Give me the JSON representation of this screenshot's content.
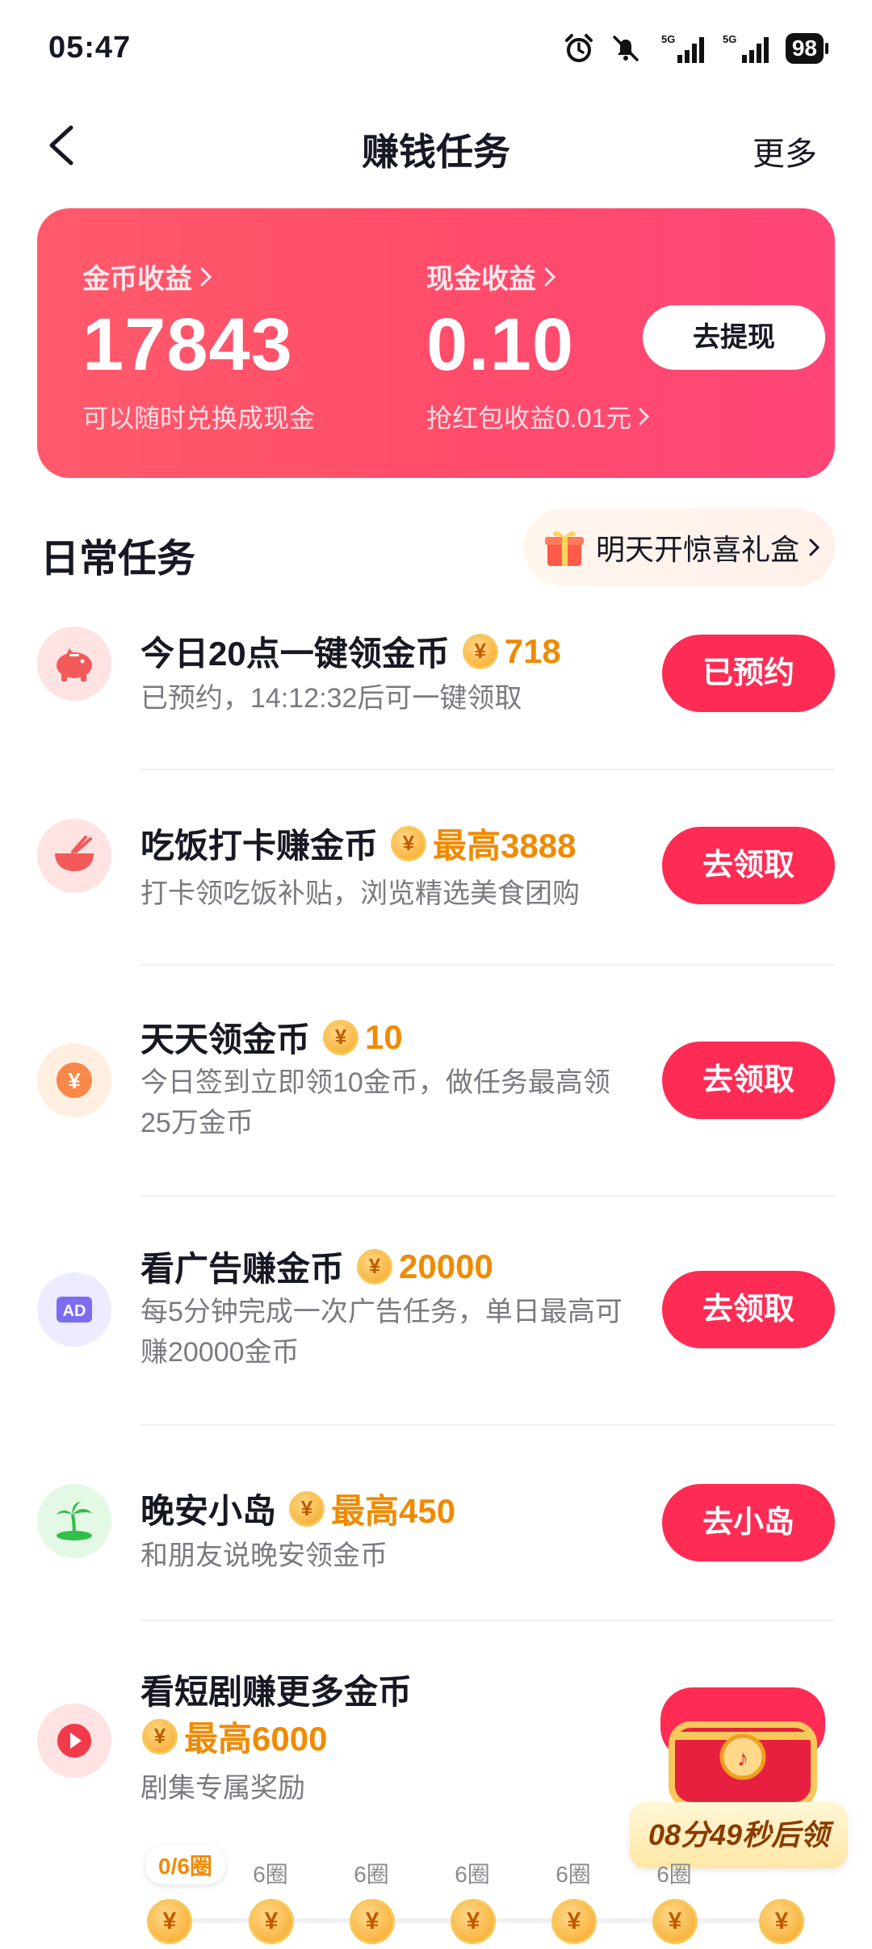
{
  "status_bar": {
    "time": "05:47",
    "battery": "98",
    "icons": [
      "alarm-icon",
      "mute-icon",
      "signal-5g-icon",
      "signal-5g-icon",
      "battery-icon"
    ]
  },
  "nav": {
    "title": "赚钱任务",
    "more": "更多"
  },
  "earnings": {
    "coin_label": "金币收益",
    "coin_value": "17843",
    "coin_sub": "可以随时兑换成现金",
    "cash_label": "现金收益",
    "cash_value": "0.10",
    "cash_sub": "抢红包收益0.01元",
    "withdraw_button": "去提现"
  },
  "daily": {
    "title": "日常任务",
    "gift_text": "明天开惊喜礼盒"
  },
  "tasks": [
    {
      "title": "今日20点一键领金币",
      "reward": "718",
      "desc": "已预约，14:12:32后可一键领取",
      "button": "已预约",
      "icon": "piggy-bank-icon"
    },
    {
      "title": "吃饭打卡赚金币",
      "reward": "最高3888",
      "desc": "打卡领吃饭补贴，浏览精选美食团购",
      "button": "去领取",
      "icon": "rice-bowl-icon"
    },
    {
      "title": "天天领金币",
      "reward": "10",
      "desc": "今日签到立即领10金币，做任务最高领25万金币",
      "button": "去领取",
      "icon": "yen-coin-icon"
    },
    {
      "title": "看广告赚金币",
      "reward": "20000",
      "desc": "每5分钟完成一次广告任务，单日最高可赚20000金币",
      "button": "去领取",
      "icon": "ad-icon"
    },
    {
      "title": "晚安小岛",
      "reward": "最高450",
      "desc": "和朋友说晚安领金币",
      "button": "去小岛",
      "icon": "palm-island-icon"
    },
    {
      "title": "看短剧赚更多金币",
      "reward": "最高6000",
      "desc": "剧集专属奖励",
      "icon": "play-icon"
    }
  ],
  "progress": {
    "current": "0/6圈",
    "steps": [
      "6圈",
      "6圈",
      "6圈",
      "6圈",
      "6圈"
    ],
    "coin_symbol": "¥"
  },
  "chest": {
    "countdown": "08分49秒后领"
  },
  "colors": {
    "accent": "#fe2c55",
    "card_gradient_start": "#ff5a6b",
    "card_gradient_end": "#ff4577",
    "reward_orange": "#f08a00"
  }
}
